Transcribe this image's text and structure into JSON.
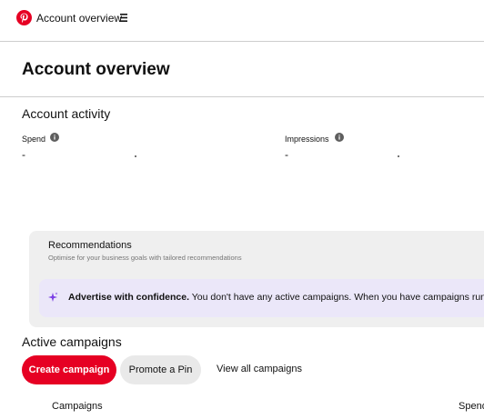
{
  "header": {
    "title": "Account overview",
    "logo_icon": "pinterest-logo-icon",
    "menu_icon": "hamburger-icon"
  },
  "page": {
    "title": "Account overview"
  },
  "activity": {
    "title": "Account activity",
    "spend_label": "Spend",
    "spend_value": "-",
    "impressions_label": "Impressions",
    "impressions_value": "-",
    "info_icon": "info-icon"
  },
  "recommendations": {
    "title": "Recommendations",
    "subtitle": "Optimise for your business goals with tailored recommendations",
    "banner_bold": "Advertise with confidence.",
    "banner_text": " You don't have any active campaigns. When you have campaigns running",
    "banner_icon": "sparkle-icon"
  },
  "campaigns": {
    "title": "Active campaigns",
    "create_label": "Create campaign",
    "promote_label": "Promote a Pin",
    "view_all_label": "View all campaigns",
    "col_campaigns": "Campaigns",
    "col_spend": "Spend"
  },
  "colors": {
    "brand_red": "#e60023",
    "banner_purple": "#ebe7f9",
    "panel_gray": "#efefef",
    "sparkle_purple": "#7b3fe4"
  }
}
